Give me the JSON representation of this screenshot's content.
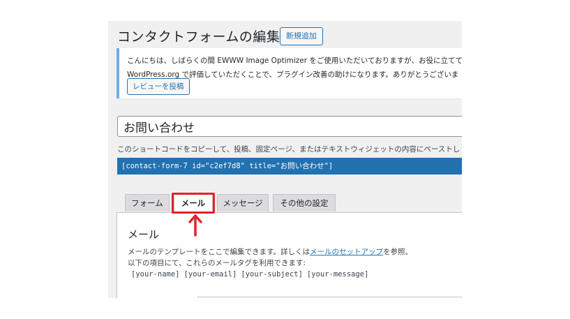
{
  "header": {
    "title": "コンタクトフォームの編集",
    "add_new_label": "新規追加"
  },
  "notice": {
    "line1": "こんにちは、しばらくの間 EWWW Image Optimizer をご使用いただいておりますが、お役に立てて",
    "line2": "WordPress.org で評価していただくことで、プラグイン改善の助けになります。ありがとうございま",
    "review_button_label": "レビューを投稿"
  },
  "form": {
    "title_value": "お問い合わせ",
    "shortcode_description": "このショートコードをコピーして、投稿、固定ページ、またはテキストウィジェットの内容にペーストし",
    "shortcode": "[contact-form-7 id=\"c2ef7d8\" title=\"お問い合わせ\"]"
  },
  "tabs": [
    {
      "label": "フォーム",
      "active": false
    },
    {
      "label": "メール",
      "active": true
    },
    {
      "label": "メッセージ",
      "active": false
    },
    {
      "label": "その他の設定",
      "active": false
    }
  ],
  "mail_panel": {
    "heading": "メール",
    "desc_prefix": "メールのテンプレートをここで編集できます。詳しくは",
    "desc_link": "メールのセットアップ",
    "desc_suffix": "を参照。",
    "desc_line2": "以下の項目にて、これらのメールタグを利用できます:",
    "mail_tags": [
      "[your-name]",
      "[your-email]",
      "[your-subject]",
      "[your-message]"
    ]
  },
  "colors": {
    "accent_blue": "#2271b1",
    "notice_border": "#72aee6",
    "highlight_red": "#e0242d",
    "background": "#f0f0f1"
  }
}
